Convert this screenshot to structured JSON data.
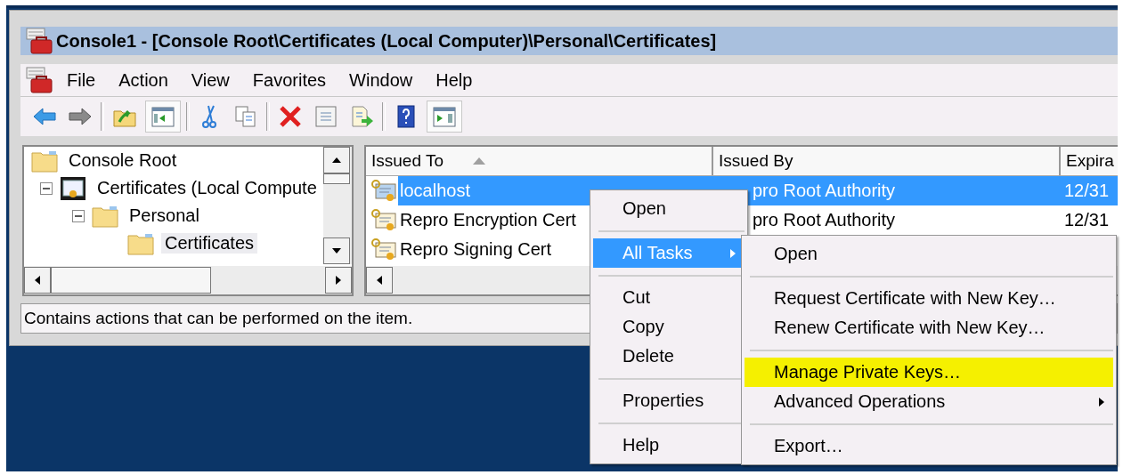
{
  "window": {
    "title": "Console1 - [Console Root\\Certificates (Local Computer)\\Personal\\Certificates]"
  },
  "menu_bar": [
    "File",
    "Action",
    "View",
    "Favorites",
    "Window",
    "Help"
  ],
  "toolbar": [
    {
      "kind": "back",
      "pressed": false
    },
    {
      "kind": "forward",
      "pressed": false
    },
    {
      "kind": "separator"
    },
    {
      "kind": "up",
      "pressed": false
    },
    {
      "kind": "tree",
      "pressed": true
    },
    {
      "kind": "separator"
    },
    {
      "kind": "cut",
      "pressed": false
    },
    {
      "kind": "copy",
      "pressed": false
    },
    {
      "kind": "separator"
    },
    {
      "kind": "delete",
      "pressed": false
    },
    {
      "kind": "properties",
      "pressed": false
    },
    {
      "kind": "export",
      "pressed": false
    },
    {
      "kind": "separator"
    },
    {
      "kind": "help",
      "pressed": false
    },
    {
      "kind": "actions",
      "pressed": true
    }
  ],
  "tree": [
    {
      "label": "Console Root",
      "selected": false,
      "children": [
        {
          "label": "Certificates (Local Compute",
          "expanded": true,
          "selected": false,
          "children": [
            {
              "label": "Personal",
              "expanded": true,
              "selected": false,
              "children": [
                {
                  "label": "Certificates",
                  "selected": true
                }
              ]
            }
          ]
        }
      ]
    }
  ],
  "list": {
    "columns": [
      {
        "label": "Issued To",
        "sorted": true
      },
      {
        "label": "Issued By",
        "sorted": false
      },
      {
        "label": "Expira",
        "sorted": false
      }
    ],
    "rows": [
      {
        "selected": true,
        "cells": [
          "localhost",
          "pro Root Authority",
          "12/31"
        ]
      },
      {
        "selected": false,
        "cells": [
          "Repro Encryption Cert",
          "pro Root Authority",
          "12/31"
        ]
      },
      {
        "selected": false,
        "cells": [
          "Repro Signing Cert",
          "",
          ""
        ]
      }
    ]
  },
  "status_bar": "Contains actions that can be performed on the item.",
  "context_menu": [
    {
      "kind": "item",
      "label": "Open",
      "selected": false,
      "submenu": false
    },
    {
      "kind": "separator"
    },
    {
      "kind": "item",
      "label": "All Tasks",
      "selected": true,
      "submenu": true
    },
    {
      "kind": "separator"
    },
    {
      "kind": "item",
      "label": "Cut",
      "selected": false,
      "submenu": false
    },
    {
      "kind": "item",
      "label": "Copy",
      "selected": false,
      "submenu": false
    },
    {
      "kind": "item",
      "label": "Delete",
      "selected": false,
      "submenu": false
    },
    {
      "kind": "separator"
    },
    {
      "kind": "item",
      "label": "Properties",
      "selected": false,
      "submenu": false
    },
    {
      "kind": "separator"
    },
    {
      "kind": "item",
      "label": "Help",
      "selected": false,
      "submenu": false
    }
  ],
  "submenu": [
    {
      "kind": "item",
      "label": "Open",
      "highlighted": false,
      "submenu": false
    },
    {
      "kind": "separator"
    },
    {
      "kind": "item",
      "label": "Request Certificate with New Key…",
      "highlighted": false,
      "submenu": false
    },
    {
      "kind": "item",
      "label": "Renew Certificate with New Key…",
      "highlighted": false,
      "submenu": false
    },
    {
      "kind": "separator"
    },
    {
      "kind": "item",
      "label": "Manage Private Keys…",
      "highlighted": true,
      "submenu": false
    },
    {
      "kind": "item",
      "label": "Advanced Operations",
      "highlighted": false,
      "submenu": true
    },
    {
      "kind": "separator"
    },
    {
      "kind": "item",
      "label": "Export…",
      "highlighted": false,
      "submenu": false
    }
  ]
}
